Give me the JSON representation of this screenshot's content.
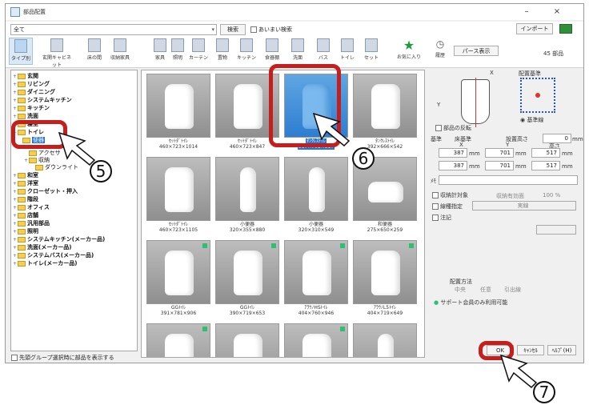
{
  "window": {
    "title": "部品配置",
    "minimize": "–",
    "close": "×"
  },
  "toolbar": {
    "category_combo": "全て",
    "search_label": "検索",
    "fuzzy_search_label": "あいまい検索",
    "import_label": "インポート"
  },
  "categories": [
    {
      "label": "タイプ別"
    },
    {
      "label": "玄関キャビネット"
    },
    {
      "label": "床の間"
    },
    {
      "label": "収納家具"
    },
    {
      "label": "家具"
    },
    {
      "label": "照明"
    },
    {
      "label": "カーテン"
    },
    {
      "label": "置物"
    },
    {
      "label": "キッチン"
    },
    {
      "label": "食器棚"
    },
    {
      "label": "洗面"
    },
    {
      "label": "バス"
    },
    {
      "label": "トイレ"
    },
    {
      "label": "セット"
    },
    {
      "label": "お気に入り"
    }
  ],
  "right_header": {
    "history_label": "履歴",
    "parts_button": "パース表示",
    "count": "45 部品"
  },
  "tree": {
    "items": [
      {
        "label": "玄関"
      },
      {
        "label": "リビング"
      },
      {
        "label": "ダイニング"
      },
      {
        "label": "システムキッチン"
      },
      {
        "label": "キッチン"
      },
      {
        "label": "洗面"
      },
      {
        "label": "寝室"
      },
      {
        "label": "トイレ"
      },
      {
        "label": "便器"
      },
      {
        "label": "アクセサ"
      },
      {
        "label": "収納"
      },
      {
        "label": "ダウンライト"
      },
      {
        "label": "和室"
      },
      {
        "label": "洋室"
      },
      {
        "label": "クローゼット・押入"
      },
      {
        "label": "階段"
      },
      {
        "label": "オフィス"
      },
      {
        "label": "店舗"
      },
      {
        "label": "汎用部品"
      },
      {
        "label": "照明"
      },
      {
        "label": "システムキッチン(メーカー品)"
      },
      {
        "label": "洗面(メーカー品)"
      },
      {
        "label": "システムバス(メーカー品)"
      },
      {
        "label": "トイレ(メーカー品)"
      }
    ]
  },
  "bottom_checkbox": "先頭グループ選択時に部品を表示する",
  "grid": {
    "cards": [
      {
        "name": "ｾｯﾄﾀﾞﾄｲﾚ",
        "dims": "460×723×1014"
      },
      {
        "name": "ｾｯﾄﾀﾞﾄｲﾚ",
        "dims": "460×723×847"
      },
      {
        "name": "ﾀﾝｸﾚｽﾄｲﾚ",
        "dims": "387×701×517"
      },
      {
        "name": "ﾀﾝｸﾚｽﾄｲﾚ",
        "dims": "392×666×542"
      },
      {
        "name": "ｾｯﾄﾀﾞﾄｲﾚ",
        "dims": "460×723×1105"
      },
      {
        "name": "小便器",
        "dims": "320×355×880"
      },
      {
        "name": "小便器",
        "dims": "320×310×549"
      },
      {
        "name": "和便器",
        "dims": "275×650×259"
      },
      {
        "name": "GGﾄｲﾚ",
        "dims": "391×781×906"
      },
      {
        "name": "GGﾄｲﾚ",
        "dims": "390×719×653"
      },
      {
        "name": "ｱﾗｳﾉHSﾄｲﾚ",
        "dims": "404×760×946"
      },
      {
        "name": "ｱﾗｳﾉL5ﾄｲﾚ",
        "dims": "404×719×649"
      }
    ]
  },
  "placement": {
    "base_label": "配置基準",
    "x_label": "X",
    "y_label": "Y",
    "flip_label": "部品の反転",
    "base_point_label": "基準線",
    "kijun_label": "基準",
    "floor_label": "床基準",
    "height_label": "設置高さ",
    "height_value": "0",
    "unit": "mm",
    "col_x": "X",
    "col_y": "Y",
    "col_h": "高さ",
    "row1": [
      "387",
      "701",
      "517"
    ],
    "row2": [
      "387",
      "701",
      "517"
    ],
    "memo_label": "ﾒﾓ",
    "storage_target": "収納計対象",
    "storage_effective": "収納有効面",
    "storage_value": "100 %",
    "line_spec": "線種指定",
    "line_value": "実線",
    "annotation": "注記",
    "method_label": "配置方法",
    "methods": [
      "中央",
      "任意",
      "引出線"
    ],
    "support_note": "サポート会員のみ利用可能"
  },
  "footer_buttons": {
    "ok": "OK",
    "cancel": "ｷｬﾝｾﾙ",
    "help": "ﾍﾙﾌﾟ(H)"
  },
  "callouts": [
    "5",
    "6",
    "7"
  ],
  "colors": {
    "annotation_red": "#c61d1d",
    "selection_blue": "#1f74d6",
    "new_badge": "#2fbf71"
  }
}
